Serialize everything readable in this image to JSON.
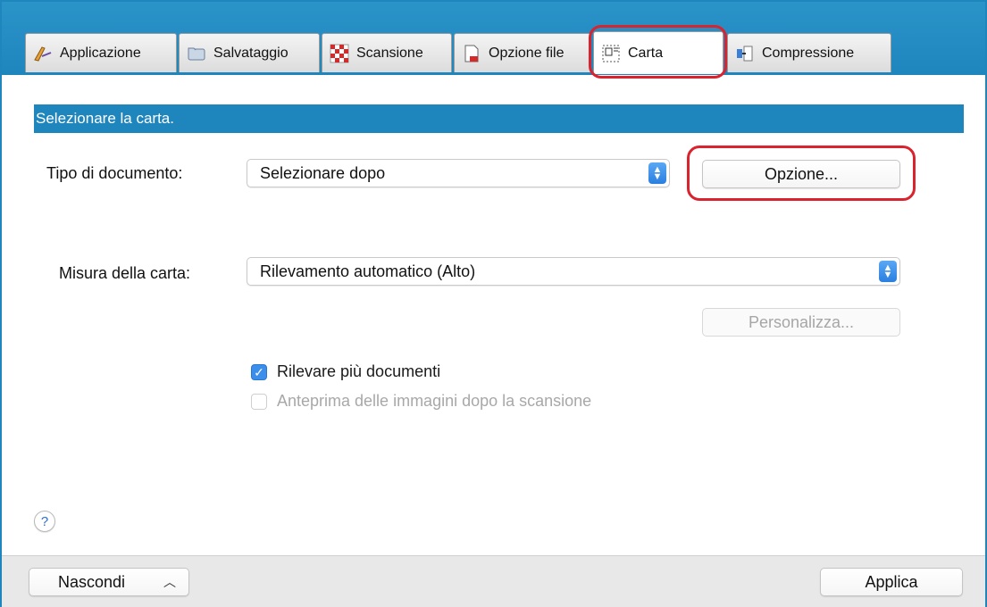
{
  "tabs": [
    {
      "label": "Applicazione",
      "icon": "pen-icon"
    },
    {
      "label": "Salvataggio",
      "icon": "folder-icon"
    },
    {
      "label": "Scansione",
      "icon": "checker-icon"
    },
    {
      "label": "Opzione file",
      "icon": "document-icon"
    },
    {
      "label": "Carta",
      "icon": "paper-icon",
      "active": true
    },
    {
      "label": "Compressione",
      "icon": "compress-icon"
    }
  ],
  "section": {
    "title": "Selezionare la carta."
  },
  "document_type": {
    "label": "Tipo di documento:",
    "value": "Selezionare dopo",
    "option_button": "Opzione..."
  },
  "paper_size": {
    "label": "Misura della carta:",
    "value": "Rilevamento automatico (Alto)",
    "customize_button": "Personalizza..."
  },
  "checkboxes": [
    {
      "label": "Rilevare più documenti",
      "checked": true,
      "enabled": true
    },
    {
      "label": "Anteprima delle immagini dopo la scansione",
      "checked": false,
      "enabled": false
    }
  ],
  "help": {
    "label": "?"
  },
  "footer": {
    "hide_button": "Nascondi",
    "apply_button": "Applica"
  },
  "colors": {
    "accent": "#1f86bd",
    "highlight": "#d9232e"
  }
}
